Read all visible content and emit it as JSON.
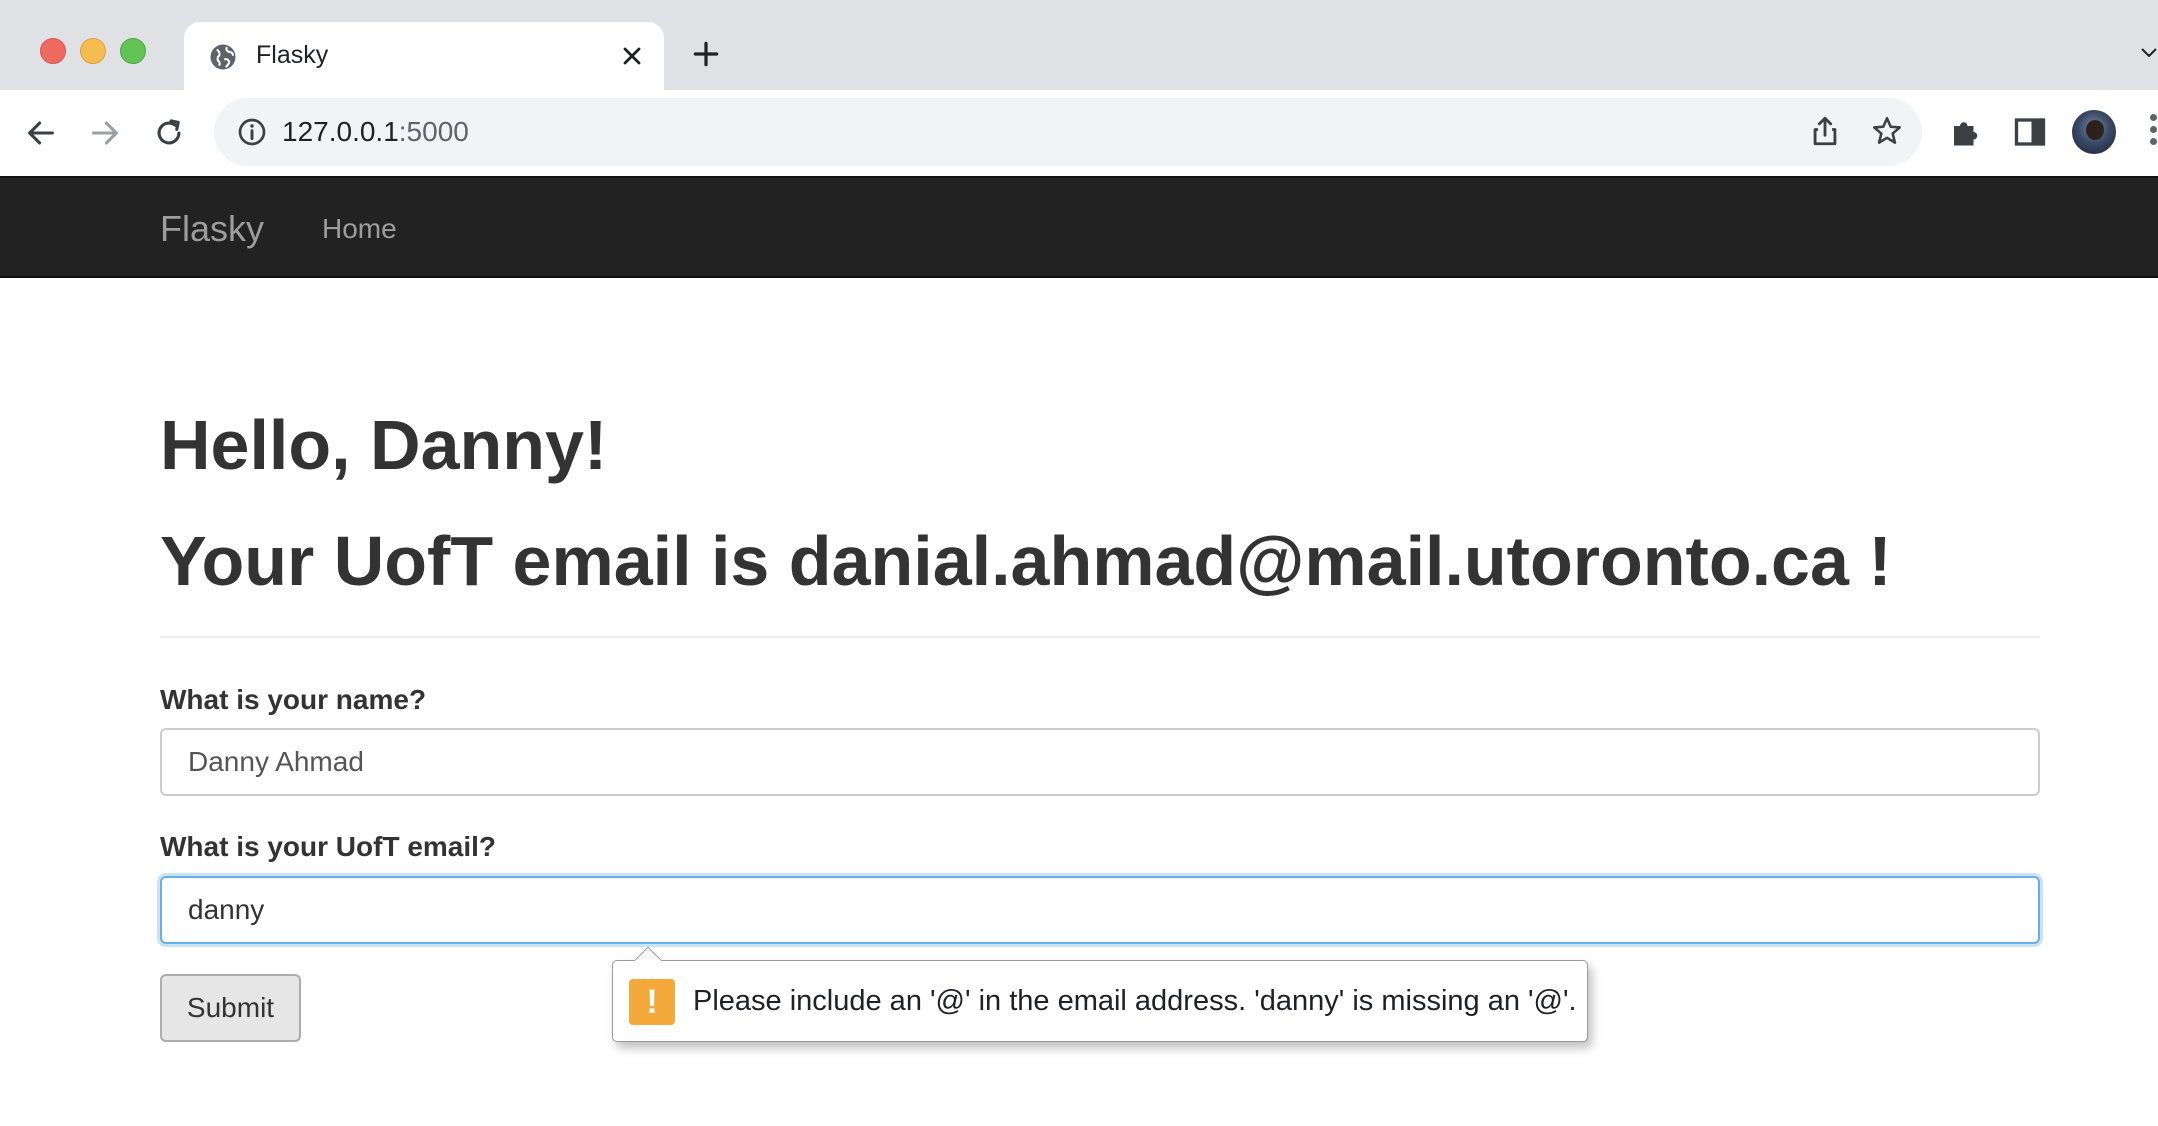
{
  "browser": {
    "tab_title": "Flasky",
    "url_host": "127.0.0.1",
    "url_port": ":5000"
  },
  "navbar": {
    "brand": "Flasky",
    "home_link": "Home"
  },
  "main": {
    "greeting": "Hello, Danny!",
    "email_message": "Your UofT email is danial.ahmad@mail.utoronto.ca !"
  },
  "form": {
    "name_label": "What is your name?",
    "name_value": "Danny Ahmad",
    "email_label": "What is your UofT email?",
    "email_value": "danny",
    "submit_label": "Submit"
  },
  "validation": {
    "message": "Please include an '@' in the email address. 'danny' is missing an '@'.",
    "icon": "exclamation-icon",
    "icon_color": "#f4a93b"
  },
  "colors": {
    "navbar_bg": "#222222",
    "focus_border": "#66afe9"
  }
}
